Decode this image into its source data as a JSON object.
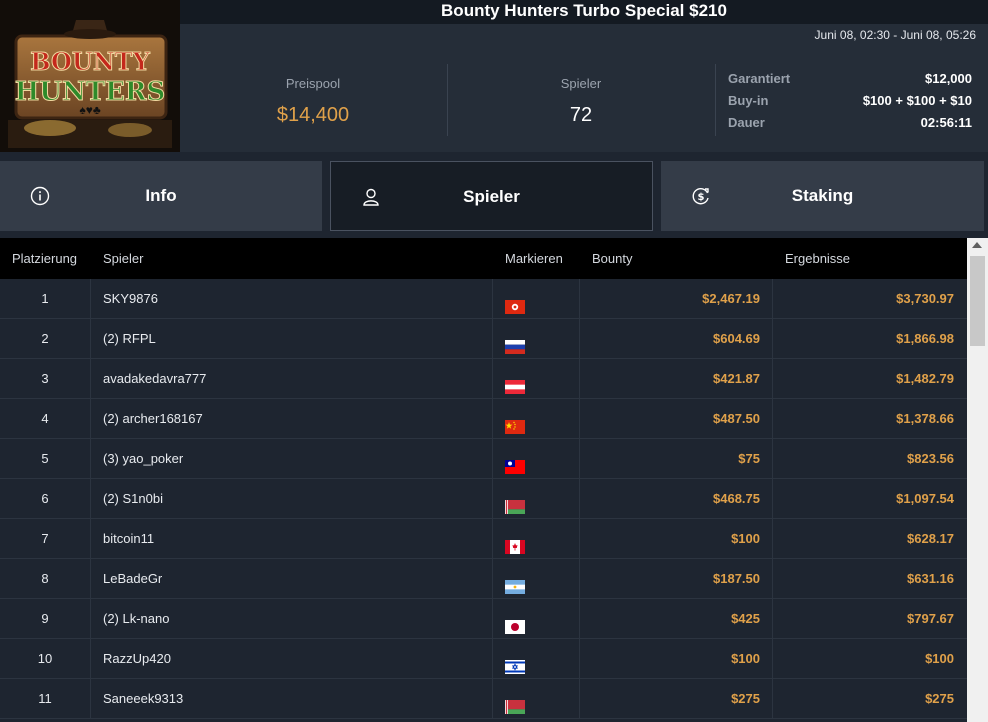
{
  "header": {
    "title": "Bounty Hunters Turbo Special $210",
    "date_range": "Juni 08, 02:30 - Juni 08, 05:26",
    "logo_icon": "bounty-hunters-logo"
  },
  "stats": {
    "prizepool_label": "Preispool",
    "prizepool_value": "$14,400",
    "players_label": "Spieler",
    "players_value": "72",
    "guaranteed_label": "Garantiert",
    "guaranteed_value": "$12,000",
    "buyin_label": "Buy-in",
    "buyin_value": "$100 + $100 + $10",
    "duration_label": "Dauer",
    "duration_value": "02:56:11"
  },
  "tabs": [
    {
      "label": "Info",
      "icon": "info-icon"
    },
    {
      "label": "Spieler",
      "icon": "user-icon"
    },
    {
      "label": "Staking",
      "icon": "dollar-cycle-icon"
    }
  ],
  "table": {
    "headers": {
      "place": "Platzierung",
      "player": "Spieler",
      "mark": "Markieren",
      "bounty": "Bounty",
      "results": "Ergebnisse"
    },
    "rows": [
      {
        "place": "1",
        "player": "SKY9876",
        "flag": "hong-kong",
        "bounty": "$2,467.19",
        "result": "$3,730.97"
      },
      {
        "place": "2",
        "player": "(2) RFPL",
        "flag": "russia",
        "bounty": "$604.69",
        "result": "$1,866.98"
      },
      {
        "place": "3",
        "player": "avadakedavra777",
        "flag": "austria",
        "bounty": "$421.87",
        "result": "$1,482.79"
      },
      {
        "place": "4",
        "player": "(2) archer168167",
        "flag": "china",
        "bounty": "$487.50",
        "result": "$1,378.66"
      },
      {
        "place": "5",
        "player": "(3) yao_poker",
        "flag": "taiwan",
        "bounty": "$75",
        "result": "$823.56"
      },
      {
        "place": "6",
        "player": "(2) S1n0bi",
        "flag": "belarus",
        "bounty": "$468.75",
        "result": "$1,097.54"
      },
      {
        "place": "7",
        "player": "bitcoin11",
        "flag": "canada",
        "bounty": "$100",
        "result": "$628.17"
      },
      {
        "place": "8",
        "player": "LeBadeGr",
        "flag": "argentina",
        "bounty": "$187.50",
        "result": "$631.16"
      },
      {
        "place": "9",
        "player": "(2) Lk-nano",
        "flag": "japan",
        "bounty": "$425",
        "result": "$797.67"
      },
      {
        "place": "10",
        "player": "RazzUp420",
        "flag": "israel",
        "bounty": "$100",
        "result": "$100"
      },
      {
        "place": "11",
        "player": "Saneeek9313",
        "flag": "belarus",
        "bounty": "$275",
        "result": "$275"
      }
    ]
  },
  "colors": {
    "accent_gold": "#e0a14a",
    "background": "#1e2530",
    "header_black": "#000000"
  }
}
